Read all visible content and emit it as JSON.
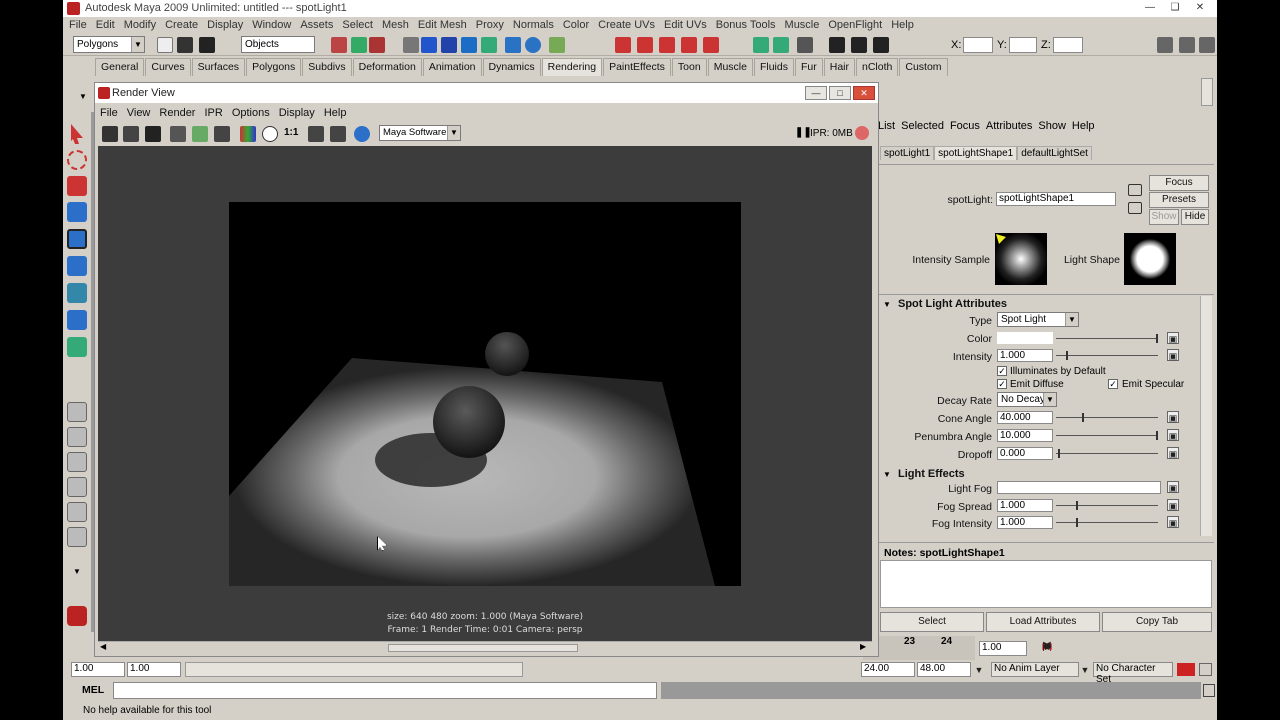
{
  "app": {
    "title": "Autodesk Maya 2009 Unlimited: untitled   ---   spotLight1",
    "menus": [
      "File",
      "Edit",
      "Modify",
      "Create",
      "Display",
      "Window",
      "Assets",
      "Select",
      "Mesh",
      "Edit Mesh",
      "Proxy",
      "Normals",
      "Color",
      "Create UVs",
      "Edit UVs",
      "Bonus Tools",
      "Muscle",
      "OpenFlight",
      "Help"
    ],
    "menuset": "Polygons",
    "selection_mode": "Objects",
    "coord_labels": {
      "x": "X:",
      "y": "Y:",
      "z": "Z:"
    }
  },
  "shelf": {
    "tabs": [
      "General",
      "Curves",
      "Surfaces",
      "Polygons",
      "Subdivs",
      "Deformation",
      "Animation",
      "Dynamics",
      "Rendering",
      "PaintEffects",
      "Toon",
      "Muscle",
      "Fluids",
      "Fur",
      "Hair",
      "nCloth",
      "Custom"
    ],
    "active_tab": "Rendering"
  },
  "render_view": {
    "title": "Render View",
    "menus": [
      "File",
      "View",
      "Render",
      "IPR",
      "Options",
      "Display",
      "Help"
    ],
    "ratio_label": "1:1",
    "renderer": "Maya Software",
    "ipr_status": "IPR: 0MB",
    "pause_icon": "pause-icon",
    "info_line1": "size:  640  480 zoom: 1.000        (Maya Software)",
    "info_line2": "Frame: 1        Render Time: 0:01        Camera: persp"
  },
  "attr_editor": {
    "menus": [
      "List",
      "Selected",
      "Focus",
      "Attributes",
      "Show",
      "Help"
    ],
    "tabs": [
      "spotLight1",
      "spotLightShape1",
      "defaultLightSet"
    ],
    "active_tab": "spotLightShape1",
    "node_label": "spotLight:",
    "node_name": "spotLightShape1",
    "buttons": {
      "focus": "Focus",
      "presets": "Presets",
      "show": "Show",
      "hide": "Hide"
    },
    "intensity_sample_label": "Intensity Sample",
    "light_shape_label": "Light Shape",
    "section_spot": "Spot Light Attributes",
    "type_label": "Type",
    "type_value": "Spot Light",
    "color_label": "Color",
    "intensity_label": "Intensity",
    "intensity_value": "1.000",
    "illuminates_label": "Illuminates by Default",
    "emit_diffuse_label": "Emit Diffuse",
    "emit_specular_label": "Emit Specular",
    "decay_label": "Decay Rate",
    "decay_value": "No Decay",
    "cone_label": "Cone Angle",
    "cone_value": "40.000",
    "penumbra_label": "Penumbra Angle",
    "penumbra_value": "10.000",
    "dropoff_label": "Dropoff",
    "dropoff_value": "0.000",
    "section_effects": "Light Effects",
    "fog_label": "Light Fog",
    "fog_spread_label": "Fog Spread",
    "fog_spread_value": "1.000",
    "fog_intensity_label": "Fog Intensity",
    "fog_intensity_value": "1.000",
    "notes_label": "Notes:  spotLightShape1",
    "bottom_buttons": [
      "Select",
      "Load Attributes",
      "Copy Tab"
    ],
    "sliders": {
      "intensity": 0.1,
      "cone": 0.25,
      "penumbra": 0.98,
      "dropoff": 0.02,
      "fog_spread": 0.2,
      "fog_intensity": 0.2,
      "color": 0.98
    }
  },
  "timeline": {
    "tick_23": "23",
    "tick_24": "24",
    "current_frame": "1.00",
    "range_start": "1.00",
    "range_start2": "1.00",
    "range_end": "24.00",
    "range_end2": "48.00",
    "anim_layer": "No Anim Layer",
    "char_set": "No Character Set"
  },
  "command_line": {
    "label": "MEL",
    "help": "No help available for this tool"
  }
}
